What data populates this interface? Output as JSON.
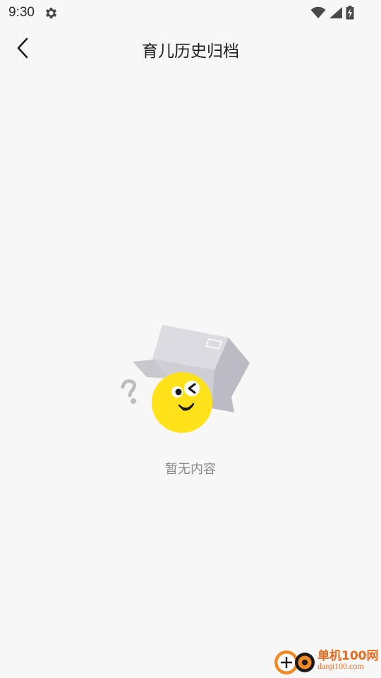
{
  "status_bar": {
    "time": "9:30",
    "icons": [
      "gear-icon",
      "wifi-icon",
      "signal-icon",
      "battery-charging-icon"
    ]
  },
  "nav": {
    "title": "育儿历史归档",
    "back_icon": "chevron-left-icon"
  },
  "empty_state": {
    "message": "暂无内容",
    "illustration": "emoji-under-box"
  },
  "watermark": {
    "title": "单机100网",
    "url": "danji100.com"
  },
  "colors": {
    "background": "#f7f7f7",
    "title_text": "#1c1c1c",
    "empty_text": "#8a8a8a",
    "emoji_yellow": "#ffe21a",
    "box_gray": "#d9d8de",
    "watermark_orange": "#e96a1a"
  }
}
